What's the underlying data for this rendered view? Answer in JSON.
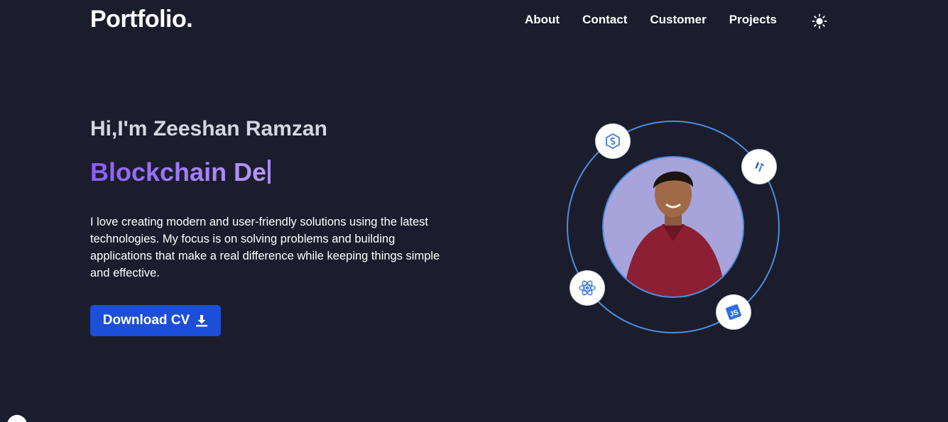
{
  "header": {
    "logo": "Portfolio.",
    "nav": [
      {
        "label": "About"
      },
      {
        "label": "Contact"
      },
      {
        "label": "Customer"
      },
      {
        "label": "Projects"
      }
    ],
    "theme_icon": "sun-icon"
  },
  "hero": {
    "greeting": "Hi,I'm Zeeshan Ramzan",
    "role_typed": "Blockchain De",
    "bio": "I love creating modern and user-friendly solutions using the latest technologies. My focus is on solving problems and building applications that make a real difference while keeping things simple and effective.",
    "download_label": "Download CV",
    "download_icon": "download-icon"
  },
  "tech_icons": [
    "solidity-icon",
    "tech-logo-icon",
    "react-icon",
    "js-icon"
  ],
  "colors": {
    "background": "#1b1d2d",
    "accent": "#1d4ed8",
    "role_gradient_start": "#8b5cf6",
    "role_gradient_end": "#b79af5",
    "orbit": "#4a8de0",
    "avatar_bg": "#a7a4dc"
  }
}
